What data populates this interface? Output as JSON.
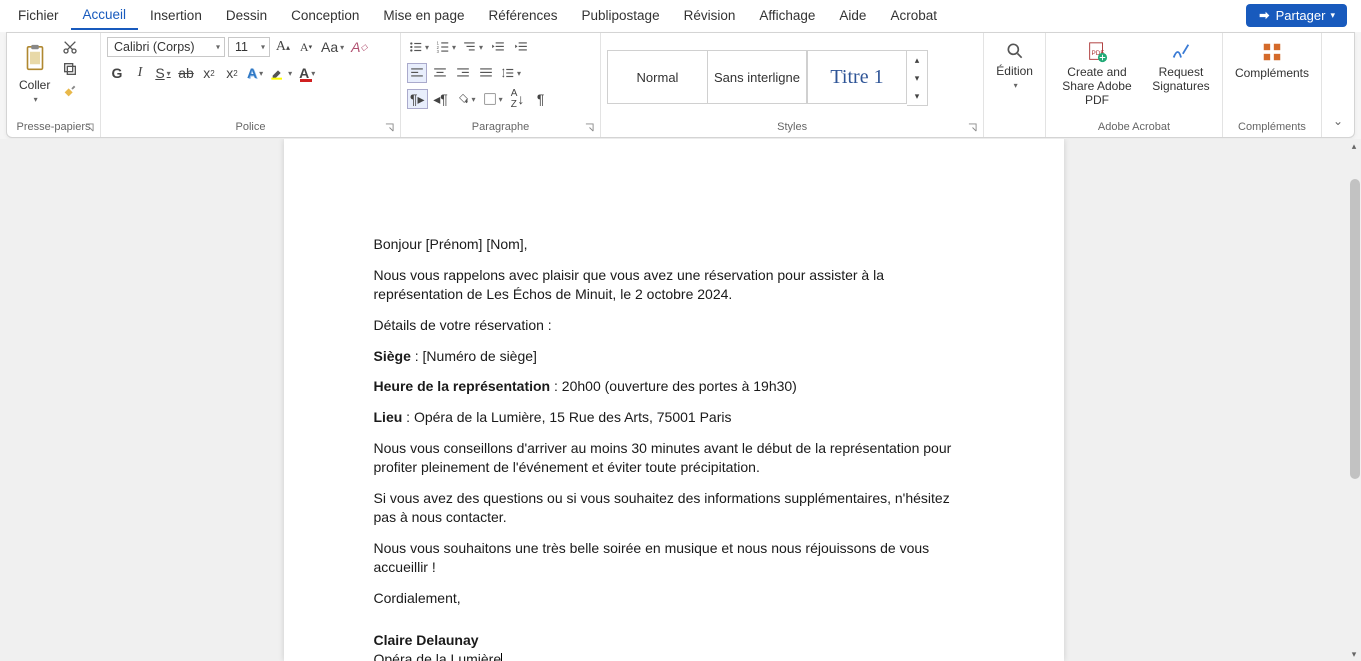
{
  "tabs": {
    "items": [
      "Fichier",
      "Accueil",
      "Insertion",
      "Dessin",
      "Conception",
      "Mise en page",
      "Références",
      "Publipostage",
      "Révision",
      "Affichage",
      "Aide",
      "Acrobat"
    ],
    "active": "Accueil",
    "share": "Partager"
  },
  "ribbon": {
    "clipboard": {
      "label": "Presse-papiers",
      "paste": "Coller"
    },
    "font": {
      "label": "Police",
      "name": "Calibri (Corps)",
      "size": "11",
      "bold": "G",
      "italic": "I",
      "underline": "S",
      "strike": "ab",
      "sub": "x",
      "sup": "x",
      "clear": "A"
    },
    "paragraph": {
      "label": "Paragraphe"
    },
    "styles": {
      "label": "Styles",
      "items": [
        "Normal",
        "Sans interligne",
        "Titre 1"
      ]
    },
    "edition": {
      "label": "Édition"
    },
    "acrobat": {
      "label": "Adobe Acrobat",
      "create": "Create and Share Adobe PDF",
      "sign": "Request Signatures"
    },
    "addins": {
      "label": "Compléments",
      "btn": "Compléments"
    }
  },
  "doc": {
    "greeting": "Bonjour [Prénom] [Nom],",
    "p1": "Nous vous rappelons avec plaisir que vous avez une réservation pour assister à la représentation de Les Échos de Minuit, le 2 octobre 2024.",
    "p2": "Détails de votre réservation :",
    "seat_label": "Siège",
    "seat_val": " : [Numéro de siège]",
    "time_label": "Heure de la représentation",
    "time_val": " : 20h00 (ouverture des portes à 19h30)",
    "place_label": "Lieu",
    "place_val": " : Opéra de la Lumière, 15 Rue des Arts, 75001 Paris",
    "p3": "Nous vous conseillons d'arriver au moins 30 minutes avant le début de la représentation pour profiter pleinement de l'événement et éviter toute précipitation.",
    "p4": "Si vous avez des questions ou si vous souhaitez des informations supplémentaires, n'hésitez pas à nous contacter.",
    "p5": "Nous vous souhaitons une très belle soirée en musique et nous nous réjouissons de vous accueillir !",
    "closing": "Cordialement,",
    "sig_name": "Claire Delaunay",
    "sig_org": "Opéra de la Lumière"
  }
}
